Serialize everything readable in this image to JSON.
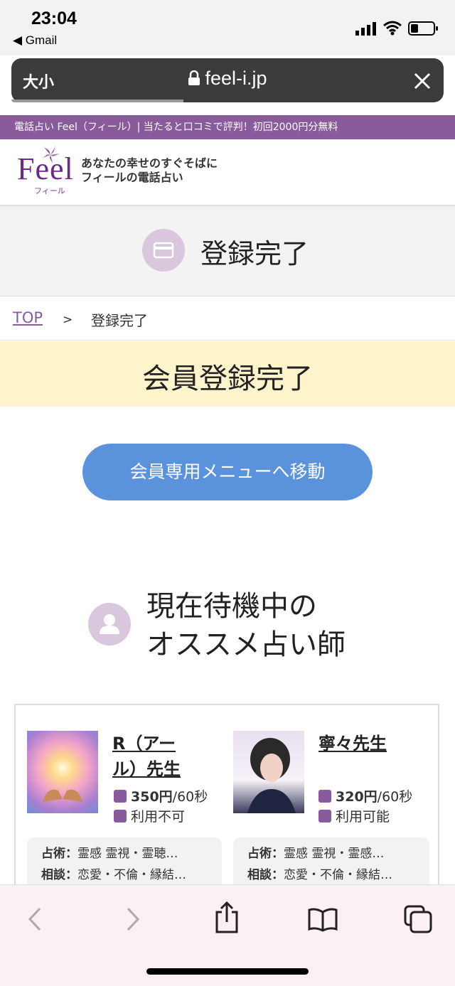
{
  "status": {
    "time": "23:04",
    "back_app": "◀ Gmail"
  },
  "browser": {
    "text_size": "大小",
    "url": "feel-i.jp"
  },
  "site": {
    "strip_text": "電話占い Feel（フィール）| 当たると口コミで評判！初回2000円分無料",
    "logo_word": "Feel",
    "logo_sub": "フィール",
    "tagline_1": "あなたの幸せのすぐそばに",
    "tagline_2": "フィールの電話占い"
  },
  "page": {
    "title": "登録完了",
    "breadcrumb": {
      "top": "TOP",
      "sep": ">",
      "current": "登録完了"
    },
    "done_heading": "会員登録完了",
    "member_button": "会員専用メニューへ移動",
    "rec_title_1": "現在待機中の",
    "rec_title_2": "オススメ占い師"
  },
  "tellers": [
    {
      "name_1": "R（アー",
      "name_2": "ル）先生",
      "price": "350円",
      "per": "/60秒",
      "availability": "利用不可",
      "tech_label": "占術：",
      "tech": "霊感 霊視・霊聴…",
      "consult_label": "相談：",
      "consult": "恋愛・不倫・縁結…"
    },
    {
      "name_1": "寧々先生",
      "price": "320円",
      "per": "/60秒",
      "availability": "利用可能",
      "tech_label": "占術：",
      "tech": "霊感 霊視・霊感…",
      "consult_label": "相談：",
      "consult": "恋愛・不倫・縁結…"
    }
  ],
  "colors": {
    "brand": "#8a5b9c",
    "button": "#5b92dc",
    "done_band": "#fdf4cc"
  }
}
